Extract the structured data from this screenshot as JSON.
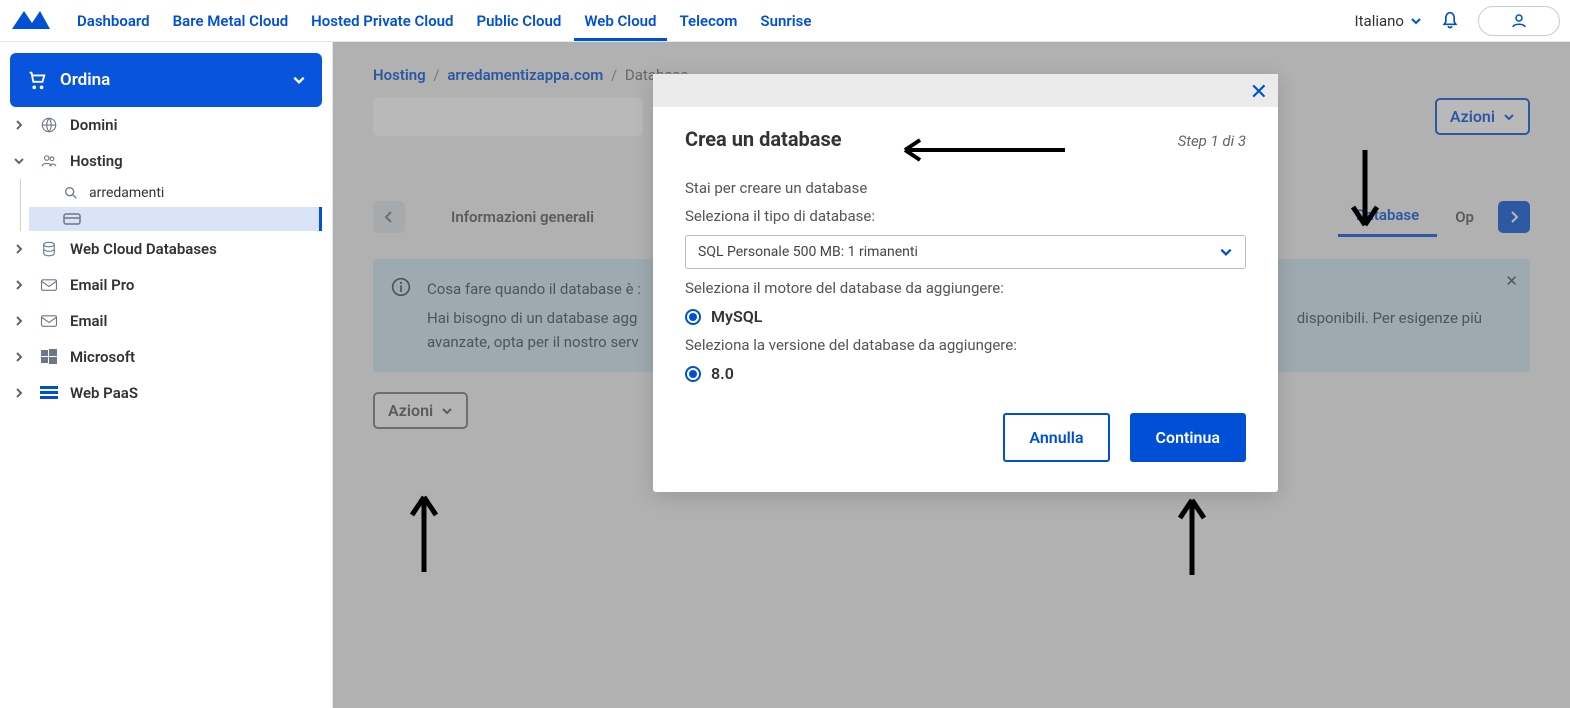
{
  "nav": {
    "links": [
      "Dashboard",
      "Bare Metal Cloud",
      "Hosted Private Cloud",
      "Public Cloud",
      "Web Cloud",
      "Telecom",
      "Sunrise"
    ],
    "active_index": 4,
    "language": "Italiano"
  },
  "sidebar": {
    "order": "Ordina",
    "items": [
      {
        "label": "Domini",
        "icon": "globe"
      },
      {
        "label": "Hosting",
        "icon": "users",
        "expanded": true,
        "children": [
          {
            "label": "arredamenti",
            "icon": "search"
          },
          {
            "label": "",
            "icon": "card",
            "selected": true
          }
        ]
      },
      {
        "label": "Web Cloud Databases",
        "icon": "db"
      },
      {
        "label": "Email Pro",
        "icon": "mail"
      },
      {
        "label": "Email",
        "icon": "mail"
      },
      {
        "label": "Microsoft",
        "icon": "windows"
      },
      {
        "label": "Web PaaS",
        "icon": "bars"
      }
    ]
  },
  "breadcrumb": {
    "a": "Hosting",
    "b": "arredamentizappa.com",
    "c": "Database"
  },
  "page": {
    "actions": "Azioni",
    "tabs": {
      "first": "Informazioni generali",
      "active": "Database",
      "next": "Op"
    },
    "alert": {
      "line1": "Cosa fare quando il database è :",
      "line2_a": "Hai bisogno di un database agg",
      "line2_b": "disponibili. Per esigenze più",
      "line3": "avanzate, opta per il nostro serv"
    },
    "actions2": "Azioni"
  },
  "modal": {
    "title": "Crea un database",
    "step": "Step 1 di 3",
    "intro": "Stai per creare un database",
    "select_label": "Seleziona il tipo di database:",
    "select_value": "SQL Personale 500 MB: 1 rimanenti",
    "engine_label": "Seleziona il motore del database da aggiungere:",
    "engine_option": "MySQL",
    "version_label": "Seleziona la versione del database da aggiungere:",
    "version_option": "8.0",
    "cancel": "Annulla",
    "continue": "Continua"
  }
}
